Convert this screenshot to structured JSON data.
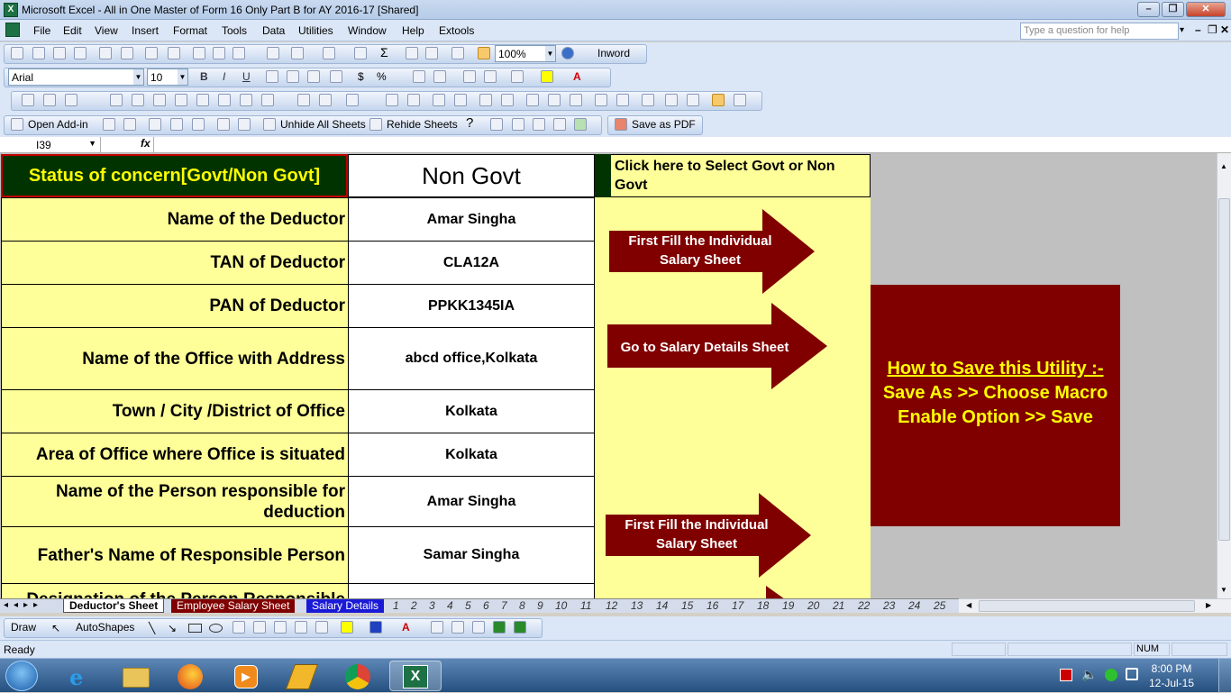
{
  "window": {
    "title": "Microsoft Excel - All in One Master of Form 16 Only Part  B for AY 2016-17  [Shared]",
    "app_icon_text": "X"
  },
  "menu": [
    "File",
    "Edit",
    "View",
    "Insert",
    "Format",
    "Tools",
    "Data",
    "Utilities",
    "Window",
    "Help",
    "Extools"
  ],
  "help_box": {
    "placeholder": "Type a question for help"
  },
  "toolbar": {
    "zoom": "100%",
    "inword": "Inword",
    "font_name": "Arial",
    "font_size": "10",
    "bold": "B",
    "italic": "I",
    "underline": "U",
    "currency": "$",
    "percent": "%",
    "open_addin": "Open Add-in",
    "unhide_all": "Unhide All Sheets",
    "rehide": "Rehide Sheets",
    "save_pdf": "Save as PDF"
  },
  "formula_bar": {
    "name_box": "I39",
    "fx": "fx",
    "content": ""
  },
  "sheet": {
    "header_label": "Status of concern[Govt/Non Govt]",
    "header_value": "Non Govt",
    "select_note": "Click here to Select Govt or Non Govt",
    "rows": [
      {
        "label": "Name of the Deductor",
        "value": "Amar Singha"
      },
      {
        "label": "TAN of Deductor",
        "value": "CLA12A"
      },
      {
        "label": "PAN of Deductor",
        "value": "PPKK1345IA"
      },
      {
        "label": "Name of the Office with Address",
        "value": "abcd office,Kolkata"
      },
      {
        "label": "Town / City /District of Office",
        "value": "Kolkata"
      },
      {
        "label": "Area of Office where Office is situated",
        "value": "Kolkata"
      },
      {
        "label": "Name of the Person responsible for deduction",
        "value": "Amar Singha"
      },
      {
        "label": "Father's Name of Responsible Person",
        "value": "Samar Singha"
      },
      {
        "label": "Designation of the Person Responsible",
        "value": ""
      }
    ],
    "arrows": [
      {
        "text": "First Fill the Individual Salary Sheet"
      },
      {
        "text": "Go to Salary Details Sheet"
      },
      {
        "text": "First Fill the Individual Salary Sheet"
      }
    ],
    "save_info": {
      "title": "How to Save this Utility :- ",
      "body": "Save As  >> Choose Macro Enable Option >> Save"
    }
  },
  "tabs": {
    "named": [
      "Deductor's Sheet",
      "Employee Salary Sheet",
      "Salary Details"
    ],
    "numbered": [
      "1",
      "2",
      "3",
      "4",
      "5",
      "6",
      "7",
      "8",
      "9",
      "10",
      "11",
      "12",
      "13",
      "14",
      "15",
      "16",
      "17",
      "18",
      "19",
      "20",
      "21",
      "22",
      "23",
      "24",
      "25"
    ]
  },
  "draw_toolbar": {
    "draw": "Draw",
    "autoshapes": "AutoShapes"
  },
  "status": {
    "left": "Ready",
    "num": "NUM"
  },
  "clock": {
    "time": "8:00 PM",
    "date": "12-Jul-15"
  },
  "colors": {
    "label_bg": "#ffff99",
    "header_bg": "#003300",
    "header_text": "#ffff00",
    "arrow": "#800000",
    "save_text": "#ffff00"
  }
}
